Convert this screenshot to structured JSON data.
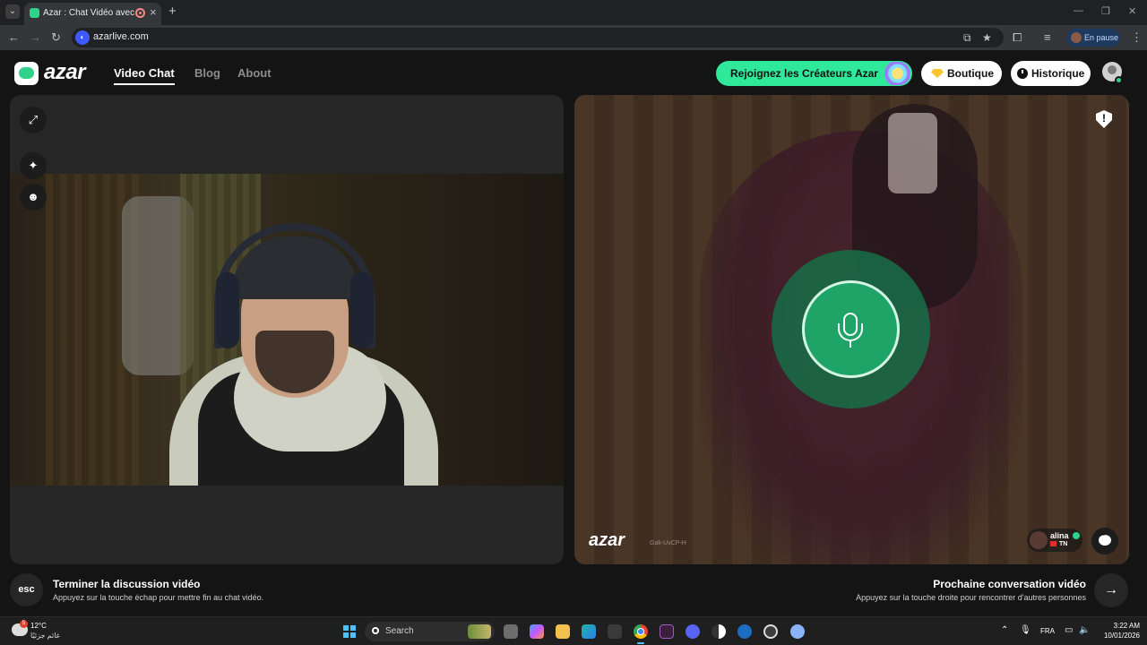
{
  "browser": {
    "tab_title": "Azar : Chat Vidéo avec de n",
    "url": "azarlive.com",
    "profile_status": "En pause"
  },
  "nav": {
    "logo": "azar",
    "links": [
      "Video Chat",
      "Blog",
      "About"
    ]
  },
  "header_actions": {
    "creators": "Rejoignez les Créateurs Azar",
    "boutique": "Boutique",
    "historique": "Historique"
  },
  "remote": {
    "watermark": "azar",
    "session_id": "Gak-UvCP-H",
    "user_name": "alina",
    "country": "TN"
  },
  "hints": {
    "esc_key": "esc",
    "end_title": "Terminer la discussion vidéo",
    "end_sub": "Appuyez sur la touche échap pour mettre fin au chat vidéo.",
    "next_title": "Prochaine conversation vidéo",
    "next_sub": "Appuyez sur la touche droite pour rencontrer d'autres personnes"
  },
  "taskbar": {
    "weather_badge": "5",
    "temperature": "12°C",
    "weather_desc": "غائم جزئيًا",
    "search_placeholder": "Search",
    "language": "FRA",
    "time": "3:22 AM",
    "date": "10/01/2026"
  },
  "colors": {
    "accent_green": "#2fe89a",
    "mic_green": "#1ea467"
  }
}
